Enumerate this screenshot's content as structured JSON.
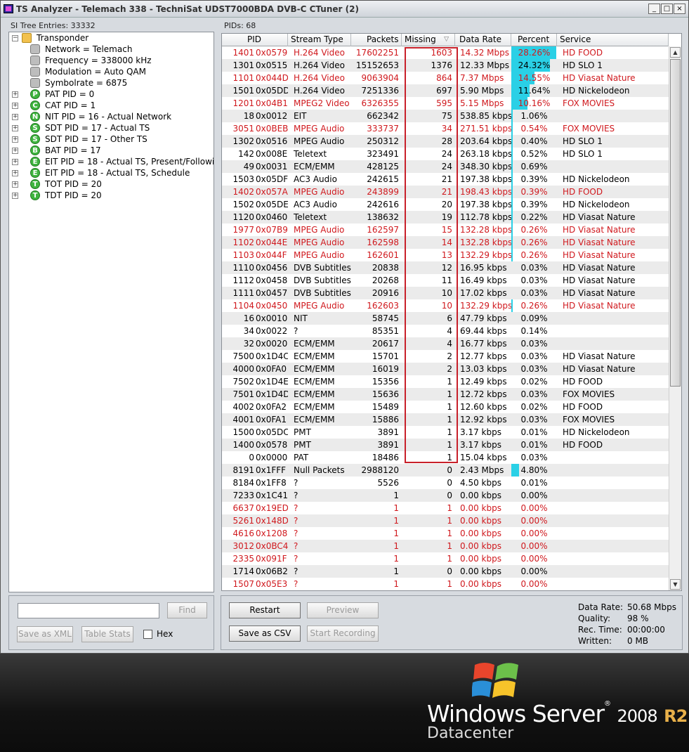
{
  "window": {
    "title": "TS Analyzer - Telemach 338 - TechniSat UDST7000BDA DVB-C CTuner (2)",
    "buttons": [
      "_",
      "□",
      "×"
    ]
  },
  "tree": {
    "label": "SI Tree Entries: 33332",
    "items": [
      {
        "level": 0,
        "icon": "folder",
        "letter": "",
        "text": "Transponder",
        "expander": "−"
      },
      {
        "level": 1,
        "icon": "gray",
        "letter": "",
        "text": "Network = Telemach",
        "expander": ""
      },
      {
        "level": 1,
        "icon": "gray",
        "letter": "",
        "text": "Frequency = 338000 kHz",
        "expander": ""
      },
      {
        "level": 1,
        "icon": "gray",
        "letter": "",
        "text": "Modulation = Auto QAM",
        "expander": ""
      },
      {
        "level": 1,
        "icon": "gray",
        "letter": "",
        "text": "Symbolrate = 6875",
        "expander": ""
      },
      {
        "level": 1,
        "icon": "green",
        "letter": "P",
        "text": "PAT PID = 0",
        "expander": "+"
      },
      {
        "level": 1,
        "icon": "green",
        "letter": "C",
        "text": "CAT PID = 1",
        "expander": "+"
      },
      {
        "level": 1,
        "icon": "green",
        "letter": "N",
        "text": "NIT PID = 16 - Actual Network",
        "expander": "+"
      },
      {
        "level": 1,
        "icon": "green",
        "letter": "S",
        "text": "SDT PID = 17 - Actual TS",
        "expander": "+"
      },
      {
        "level": 1,
        "icon": "green",
        "letter": "S",
        "text": "SDT PID = 17 - Other TS",
        "expander": "+"
      },
      {
        "level": 1,
        "icon": "green",
        "letter": "B",
        "text": "BAT PID = 17",
        "expander": "+"
      },
      {
        "level": 1,
        "icon": "green",
        "letter": "E",
        "text": "EIT PID = 18 - Actual TS, Present/Following",
        "expander": "+"
      },
      {
        "level": 1,
        "icon": "green",
        "letter": "E",
        "text": "EIT PID = 18 - Actual TS, Schedule",
        "expander": "+"
      },
      {
        "level": 1,
        "icon": "green",
        "letter": "T",
        "text": "TOT PID = 20",
        "expander": "+"
      },
      {
        "level": 1,
        "icon": "green",
        "letter": "T",
        "text": "TDT PID = 20",
        "expander": "+"
      }
    ]
  },
  "left_controls": {
    "find_value": "",
    "find_label": "Find",
    "save_xml_label": "Save as XML",
    "table_stats_label": "Table Stats",
    "hex_label": "Hex"
  },
  "grid": {
    "label": "PIDs: 68",
    "columns": [
      "PID",
      "Stream Type",
      "Packets",
      "Missing",
      "Data Rate",
      "Percent",
      "Service"
    ],
    "sort_indicator": "▽",
    "highlight_color": "#d0191e",
    "bar_color": "#2ad0e6",
    "rows": [
      {
        "pid": "1401",
        "hex": "0x0579",
        "type": "H.264 Video",
        "packets": "17602251",
        "missing": "1603",
        "rate": "14.32 Mbps",
        "pct": "28.26%",
        "pct_val": 28.26,
        "svc": "HD FOOD",
        "red": true
      },
      {
        "pid": "1301",
        "hex": "0x0515",
        "type": "H.264 Video",
        "packets": "15152653",
        "missing": "1376",
        "rate": "12.33 Mbps",
        "pct": "24.32%",
        "pct_val": 24.32,
        "svc": "HD SLO 1",
        "red": false
      },
      {
        "pid": "1101",
        "hex": "0x044D",
        "type": "H.264 Video",
        "packets": "9063904",
        "missing": "864",
        "rate": "7.37 Mbps",
        "pct": "14.55%",
        "pct_val": 14.55,
        "svc": "HD Viasat Nature",
        "red": true
      },
      {
        "pid": "1501",
        "hex": "0x05DD",
        "type": "H.264 Video",
        "packets": "7251336",
        "missing": "697",
        "rate": "5.90 Mbps",
        "pct": "11.64%",
        "pct_val": 11.64,
        "svc": "HD Nickelodeon",
        "red": false
      },
      {
        "pid": "1201",
        "hex": "0x04B1",
        "type": "MPEG2 Video",
        "packets": "6326355",
        "missing": "595",
        "rate": "5.15 Mbps",
        "pct": "10.16%",
        "pct_val": 10.16,
        "svc": "FOX MOVIES",
        "red": true
      },
      {
        "pid": "18",
        "hex": "0x0012",
        "type": "EIT",
        "packets": "662342",
        "missing": "75",
        "rate": "538.85 kbps",
        "pct": "1.06%",
        "pct_val": 1.06,
        "svc": "",
        "red": false
      },
      {
        "pid": "3051",
        "hex": "0x0BEB",
        "type": "MPEG Audio",
        "packets": "333737",
        "missing": "34",
        "rate": "271.51 kbps",
        "pct": "0.54%",
        "pct_val": 0.54,
        "svc": "FOX MOVIES",
        "red": true
      },
      {
        "pid": "1302",
        "hex": "0x0516",
        "type": "MPEG Audio",
        "packets": "250312",
        "missing": "28",
        "rate": "203.64 kbps",
        "pct": "0.40%",
        "pct_val": 0.4,
        "svc": "HD SLO 1",
        "red": false
      },
      {
        "pid": "142",
        "hex": "0x008E",
        "type": "Teletext",
        "packets": "323491",
        "missing": "24",
        "rate": "263.18 kbps",
        "pct": "0.52%",
        "pct_val": 0.52,
        "svc": "HD SLO 1",
        "red": false
      },
      {
        "pid": "49",
        "hex": "0x0031",
        "type": "ECM/EMM",
        "packets": "428125",
        "missing": "24",
        "rate": "348.30 kbps",
        "pct": "0.69%",
        "pct_val": 0.69,
        "svc": "",
        "red": false
      },
      {
        "pid": "1503",
        "hex": "0x05DF",
        "type": "AC3 Audio",
        "packets": "242615",
        "missing": "21",
        "rate": "197.38 kbps",
        "pct": "0.39%",
        "pct_val": 0.39,
        "svc": "HD Nickelodeon",
        "red": false
      },
      {
        "pid": "1402",
        "hex": "0x057A",
        "type": "MPEG Audio",
        "packets": "243899",
        "missing": "21",
        "rate": "198.43 kbps",
        "pct": "0.39%",
        "pct_val": 0.39,
        "svc": "HD FOOD",
        "red": true
      },
      {
        "pid": "1502",
        "hex": "0x05DE",
        "type": "AC3 Audio",
        "packets": "242616",
        "missing": "20",
        "rate": "197.38 kbps",
        "pct": "0.39%",
        "pct_val": 0.39,
        "svc": "HD Nickelodeon",
        "red": false
      },
      {
        "pid": "1120",
        "hex": "0x0460",
        "type": "Teletext",
        "packets": "138632",
        "missing": "19",
        "rate": "112.78 kbps",
        "pct": "0.22%",
        "pct_val": 0.22,
        "svc": "HD Viasat Nature",
        "red": false
      },
      {
        "pid": "1977",
        "hex": "0x07B9",
        "type": "MPEG Audio",
        "packets": "162597",
        "missing": "15",
        "rate": "132.28 kbps",
        "pct": "0.26%",
        "pct_val": 0.26,
        "svc": "HD Viasat Nature",
        "red": true
      },
      {
        "pid": "1102",
        "hex": "0x044E",
        "type": "MPEG Audio",
        "packets": "162598",
        "missing": "14",
        "rate": "132.28 kbps",
        "pct": "0.26%",
        "pct_val": 0.26,
        "svc": "HD Viasat Nature",
        "red": true
      },
      {
        "pid": "1103",
        "hex": "0x044F",
        "type": "MPEG Audio",
        "packets": "162601",
        "missing": "13",
        "rate": "132.29 kbps",
        "pct": "0.26%",
        "pct_val": 0.26,
        "svc": "HD Viasat Nature",
        "red": true
      },
      {
        "pid": "1110",
        "hex": "0x0456",
        "type": "DVB Subtitles",
        "packets": "20838",
        "missing": "12",
        "rate": "16.95 kbps",
        "pct": "0.03%",
        "pct_val": 0.03,
        "svc": "HD Viasat Nature",
        "red": false
      },
      {
        "pid": "1112",
        "hex": "0x0458",
        "type": "DVB Subtitles",
        "packets": "20268",
        "missing": "11",
        "rate": "16.49 kbps",
        "pct": "0.03%",
        "pct_val": 0.03,
        "svc": "HD Viasat Nature",
        "red": false
      },
      {
        "pid": "1111",
        "hex": "0x0457",
        "type": "DVB Subtitles",
        "packets": "20916",
        "missing": "10",
        "rate": "17.02 kbps",
        "pct": "0.03%",
        "pct_val": 0.03,
        "svc": "HD Viasat Nature",
        "red": false
      },
      {
        "pid": "1104",
        "hex": "0x0450",
        "type": "MPEG Audio",
        "packets": "162603",
        "missing": "10",
        "rate": "132.29 kbps",
        "pct": "0.26%",
        "pct_val": 0.26,
        "svc": "HD Viasat Nature",
        "red": true
      },
      {
        "pid": "16",
        "hex": "0x0010",
        "type": "NIT",
        "packets": "58745",
        "missing": "6",
        "rate": "47.79 kbps",
        "pct": "0.09%",
        "pct_val": 0.09,
        "svc": "",
        "red": false
      },
      {
        "pid": "34",
        "hex": "0x0022",
        "type": "?",
        "packets": "85351",
        "missing": "4",
        "rate": "69.44 kbps",
        "pct": "0.14%",
        "pct_val": 0.14,
        "svc": "",
        "red": false
      },
      {
        "pid": "32",
        "hex": "0x0020",
        "type": "ECM/EMM",
        "packets": "20617",
        "missing": "4",
        "rate": "16.77 kbps",
        "pct": "0.03%",
        "pct_val": 0.03,
        "svc": "",
        "red": false
      },
      {
        "pid": "7500",
        "hex": "0x1D4C",
        "type": "ECM/EMM",
        "packets": "15701",
        "missing": "2",
        "rate": "12.77 kbps",
        "pct": "0.03%",
        "pct_val": 0.03,
        "svc": "HD Viasat Nature",
        "red": false
      },
      {
        "pid": "4000",
        "hex": "0x0FA0",
        "type": "ECM/EMM",
        "packets": "16019",
        "missing": "2",
        "rate": "13.03 kbps",
        "pct": "0.03%",
        "pct_val": 0.03,
        "svc": "HD Viasat Nature",
        "red": false
      },
      {
        "pid": "7502",
        "hex": "0x1D4E",
        "type": "ECM/EMM",
        "packets": "15356",
        "missing": "1",
        "rate": "12.49 kbps",
        "pct": "0.02%",
        "pct_val": 0.02,
        "svc": "HD FOOD",
        "red": false
      },
      {
        "pid": "7501",
        "hex": "0x1D4D",
        "type": "ECM/EMM",
        "packets": "15636",
        "missing": "1",
        "rate": "12.72 kbps",
        "pct": "0.03%",
        "pct_val": 0.03,
        "svc": "FOX MOVIES",
        "red": false
      },
      {
        "pid": "4002",
        "hex": "0x0FA2",
        "type": "ECM/EMM",
        "packets": "15489",
        "missing": "1",
        "rate": "12.60 kbps",
        "pct": "0.02%",
        "pct_val": 0.02,
        "svc": "HD FOOD",
        "red": false
      },
      {
        "pid": "4001",
        "hex": "0x0FA1",
        "type": "ECM/EMM",
        "packets": "15886",
        "missing": "1",
        "rate": "12.92 kbps",
        "pct": "0.03%",
        "pct_val": 0.03,
        "svc": "FOX MOVIES",
        "red": false
      },
      {
        "pid": "1500",
        "hex": "0x05DC",
        "type": "PMT",
        "packets": "3891",
        "missing": "1",
        "rate": "3.17 kbps",
        "pct": "0.01%",
        "pct_val": 0.01,
        "svc": "HD Nickelodeon",
        "red": false
      },
      {
        "pid": "1400",
        "hex": "0x0578",
        "type": "PMT",
        "packets": "3891",
        "missing": "1",
        "rate": "3.17 kbps",
        "pct": "0.01%",
        "pct_val": 0.01,
        "svc": "HD FOOD",
        "red": false
      },
      {
        "pid": "0",
        "hex": "0x0000",
        "type": "PAT",
        "packets": "18486",
        "missing": "1",
        "rate": "15.04 kbps",
        "pct": "0.03%",
        "pct_val": 0.03,
        "svc": "",
        "red": false
      },
      {
        "pid": "8191",
        "hex": "0x1FFF",
        "type": "Null Packets",
        "packets": "2988120",
        "missing": "0",
        "rate": "2.43 Mbps",
        "pct": "4.80%",
        "pct_val": 4.8,
        "svc": "",
        "red": false
      },
      {
        "pid": "8184",
        "hex": "0x1FF8",
        "type": "?",
        "packets": "5526",
        "missing": "0",
        "rate": "4.50 kbps",
        "pct": "0.01%",
        "pct_val": 0.01,
        "svc": "",
        "red": false
      },
      {
        "pid": "7233",
        "hex": "0x1C41",
        "type": "?",
        "packets": "1",
        "missing": "0",
        "rate": "0.00 kbps",
        "pct": "0.00%",
        "pct_val": 0,
        "svc": "",
        "red": false
      },
      {
        "pid": "6637",
        "hex": "0x19ED",
        "type": "?",
        "packets": "1",
        "missing": "1",
        "rate": "0.00 kbps",
        "pct": "0.00%",
        "pct_val": 0,
        "svc": "",
        "red": true
      },
      {
        "pid": "5261",
        "hex": "0x148D",
        "type": "?",
        "packets": "1",
        "missing": "1",
        "rate": "0.00 kbps",
        "pct": "0.00%",
        "pct_val": 0,
        "svc": "",
        "red": true
      },
      {
        "pid": "4616",
        "hex": "0x1208",
        "type": "?",
        "packets": "1",
        "missing": "1",
        "rate": "0.00 kbps",
        "pct": "0.00%",
        "pct_val": 0,
        "svc": "",
        "red": true
      },
      {
        "pid": "3012",
        "hex": "0x0BC4",
        "type": "?",
        "packets": "1",
        "missing": "1",
        "rate": "0.00 kbps",
        "pct": "0.00%",
        "pct_val": 0,
        "svc": "",
        "red": true
      },
      {
        "pid": "2335",
        "hex": "0x091F",
        "type": "?",
        "packets": "1",
        "missing": "1",
        "rate": "0.00 kbps",
        "pct": "0.00%",
        "pct_val": 0,
        "svc": "",
        "red": true
      },
      {
        "pid": "1714",
        "hex": "0x06B2",
        "type": "?",
        "packets": "1",
        "missing": "0",
        "rate": "0.00 kbps",
        "pct": "0.00%",
        "pct_val": 0,
        "svc": "",
        "red": false
      },
      {
        "pid": "1507",
        "hex": "0x05E3",
        "type": "?",
        "packets": "1",
        "missing": "1",
        "rate": "0.00 kbps",
        "pct": "0.00%",
        "pct_val": 0,
        "svc": "",
        "red": true
      }
    ]
  },
  "right_controls": {
    "restart_label": "Restart",
    "preview_label": "Preview",
    "save_csv_label": "Save as CSV",
    "start_recording_label": "Start Recording"
  },
  "stats": [
    {
      "key": "Data Rate:",
      "value": "50.68 Mbps"
    },
    {
      "key": "Quality:",
      "value": "98 %"
    },
    {
      "key": "Rec. Time:",
      "value": "00:00:00"
    },
    {
      "key": "Written:",
      "value": "0 MB"
    }
  ],
  "desktop": {
    "brand_main": "Windows Server",
    "brand_tm": "®",
    "brand_year": "2008",
    "brand_r2": "R2",
    "brand_edition": "Datacenter"
  }
}
